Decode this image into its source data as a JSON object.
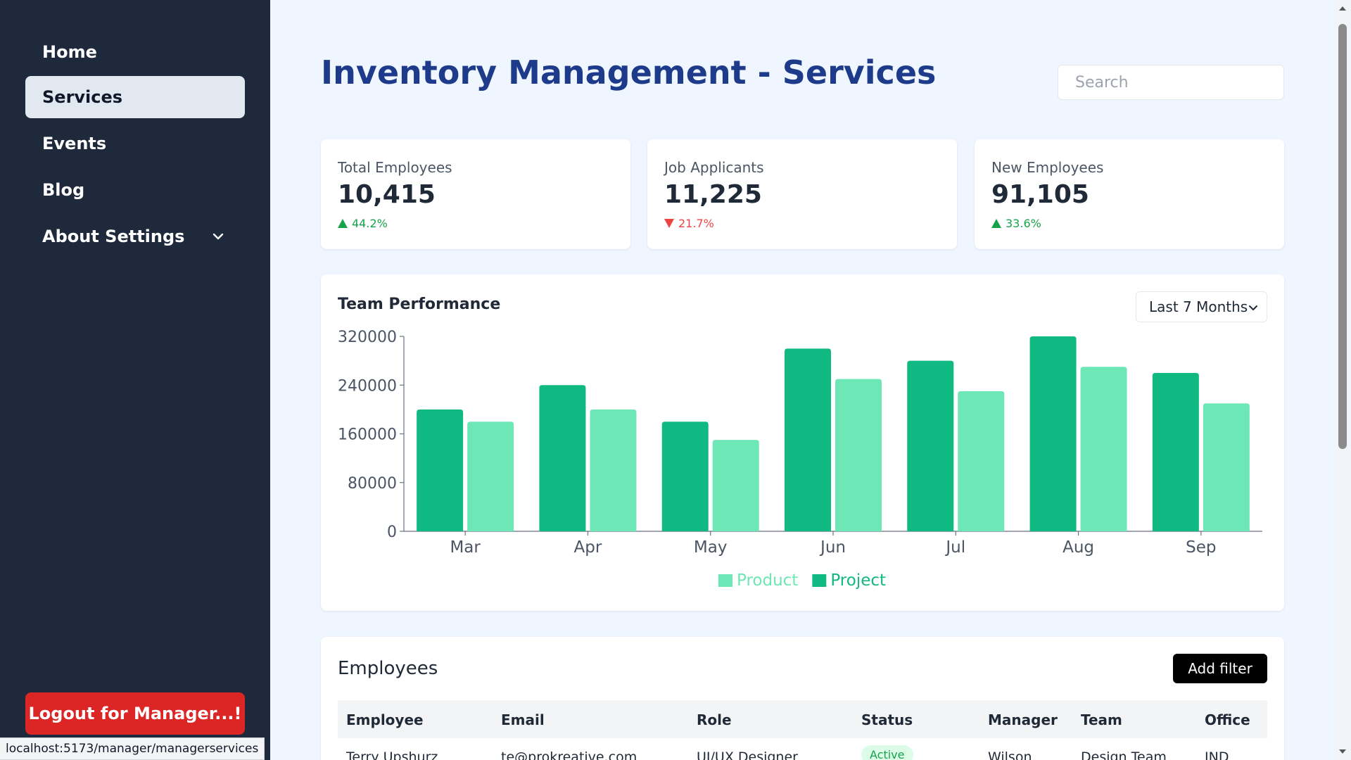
{
  "sidebar": {
    "items": [
      {
        "label": "Home"
      },
      {
        "label": "Services"
      },
      {
        "label": "Events"
      },
      {
        "label": "Blog"
      },
      {
        "label": "About Settings"
      }
    ],
    "logout_label": "Logout for Manager...!"
  },
  "status_bar": {
    "url": "localhost:5173/manager/managerservices"
  },
  "header": {
    "title": "Inventory Management - Services",
    "search_placeholder": "Search"
  },
  "stats": [
    {
      "label": "Total Employees",
      "value": "10,415",
      "delta": "44.2%",
      "trend": "up"
    },
    {
      "label": "Job Applicants",
      "value": "11,225",
      "delta": "21.7%",
      "trend": "down"
    },
    {
      "label": "New Employees",
      "value": "91,105",
      "delta": "33.6%",
      "trend": "up"
    }
  ],
  "chart_panel": {
    "title": "Team Performance",
    "range_label": "Last 7 Months"
  },
  "chart_data": {
    "type": "bar",
    "title": "Team Performance",
    "categories": [
      "Mar",
      "Apr",
      "May",
      "Jun",
      "Jul",
      "Aug",
      "Sep"
    ],
    "series": [
      {
        "name": "Project",
        "color": "#10b981",
        "values": [
          200000,
          240000,
          180000,
          300000,
          280000,
          320000,
          260000
        ]
      },
      {
        "name": "Product",
        "color": "#6ee7b7",
        "values": [
          180000,
          200000,
          150000,
          250000,
          230000,
          270000,
          210000
        ]
      }
    ],
    "ylim": [
      0,
      320000
    ],
    "yticks": [
      0,
      80000,
      160000,
      240000,
      320000
    ],
    "legend_order": [
      "Product",
      "Project"
    ],
    "legend_position": "bottom-center",
    "grid": false
  },
  "employees": {
    "title": "Employees",
    "add_filter_label": "Add filter",
    "columns": [
      "Employee",
      "Email",
      "Role",
      "Status",
      "Manager",
      "Team",
      "Office"
    ],
    "rows": [
      {
        "employee": "Terry Upshurz",
        "email": "te@prokreative.com",
        "role": "UI/UX Designer",
        "status": "Active",
        "manager": "Wilson",
        "team": "Design Team",
        "office": "IND"
      }
    ]
  },
  "colors": {
    "sidebar_bg": "#1e293b",
    "title": "#1e3a8a",
    "logout": "#dc2626",
    "up": "#16a34a",
    "down": "#ef4444"
  }
}
